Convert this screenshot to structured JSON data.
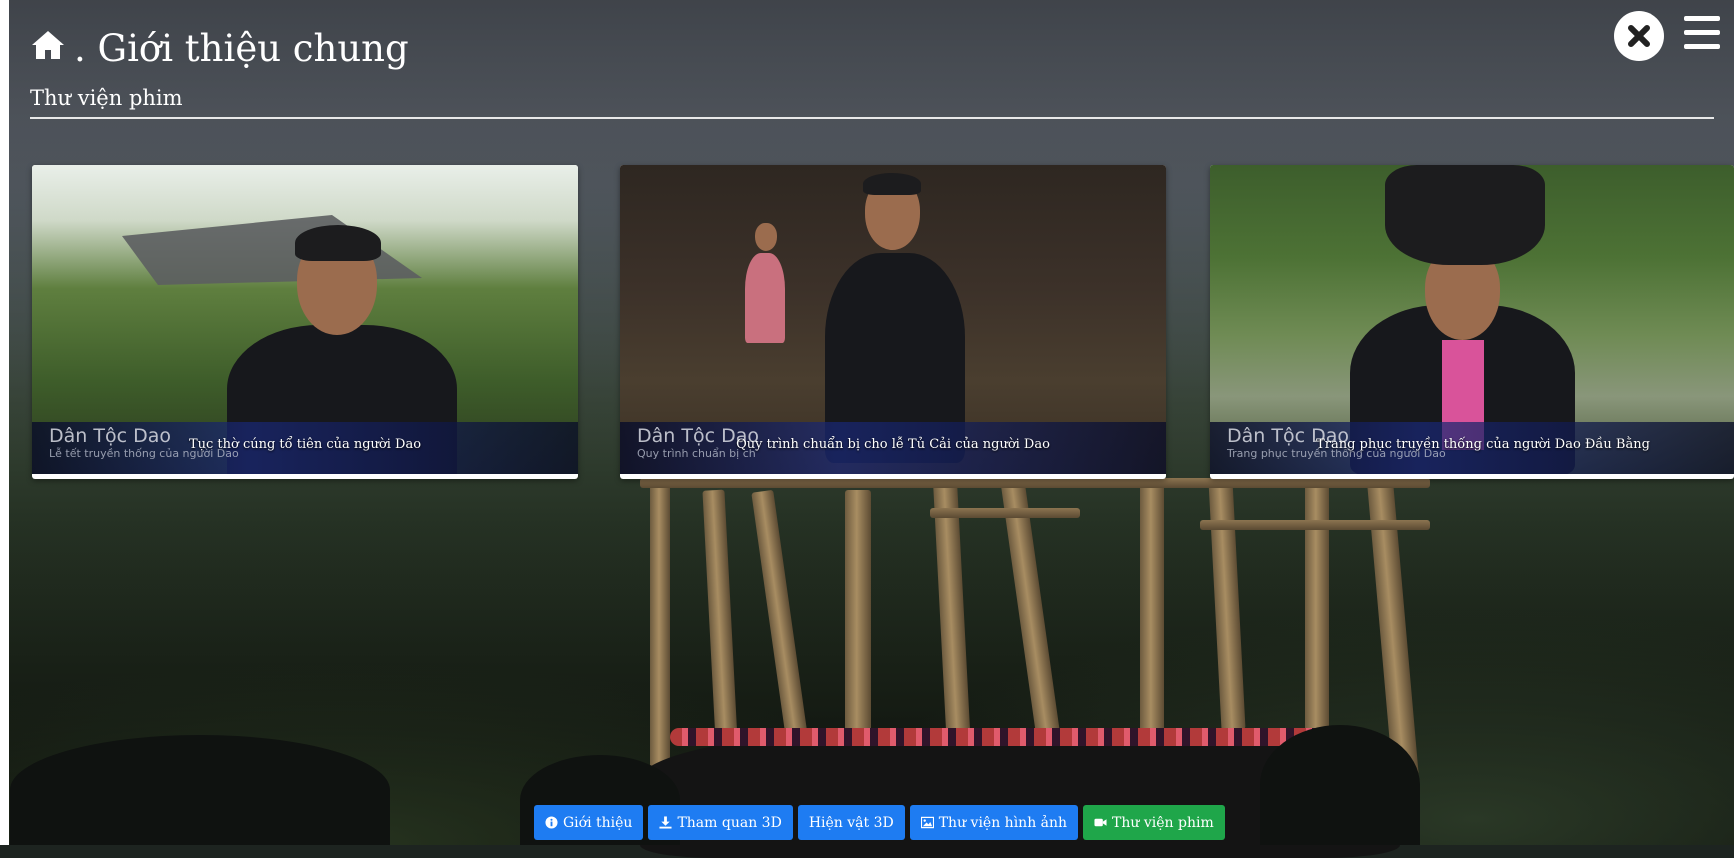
{
  "header": {
    "title": ". Giới thiệu chung",
    "subtitle": "Thư viện phim",
    "home_icon": "home-icon",
    "close_icon": "close-icon",
    "menu_icon": "hamburger-menu-icon"
  },
  "videos": [
    {
      "caption": "Tục thờ cúng tổ tiên của người Dao",
      "watermark_title": "Dân Tộc Dao",
      "watermark_subtitle": "Lễ tết truyền thống của người Dao"
    },
    {
      "caption": "Quy trình chuẩn bị cho lễ Tủ Cải của người Dao",
      "watermark_title": "Dân Tộc Dao",
      "watermark_subtitle": "Quy trình chuẩn bị ch"
    },
    {
      "caption": "Trang phục truyền thống của người Dao Đầu Bằng",
      "watermark_title": "Dân Tộc Dao",
      "watermark_subtitle": "Trang phục truyền thống của người Dao"
    }
  ],
  "bottom_nav": [
    {
      "label": "Giới thiệu",
      "icon": "info-icon",
      "active": false
    },
    {
      "label": "Tham quan 3D",
      "icon": "download-icon",
      "active": false
    },
    {
      "label": "Hiện vật 3D",
      "icon": "",
      "active": false
    },
    {
      "label": "Thư viện hình ảnh",
      "icon": "image-icon",
      "active": false
    },
    {
      "label": "Thư viện phim",
      "icon": "video-camera-icon",
      "active": true
    }
  ],
  "colors": {
    "nav_button": "#1e7cf2",
    "nav_button_active": "#1fa64a"
  }
}
